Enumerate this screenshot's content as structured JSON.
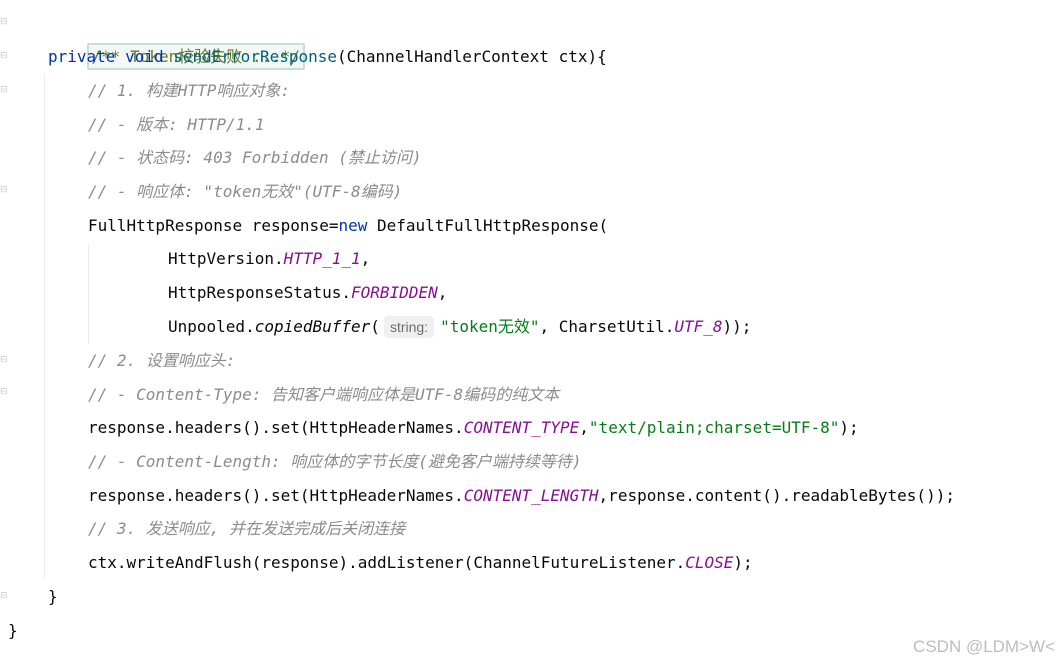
{
  "editor": {
    "doc_fold": "/** Token校验失败 ...*/",
    "method_sig": {
      "kw_private": "private",
      "kw_void": "void",
      "name": "sendErrorResponse",
      "params": "(ChannelHandlerContext ctx){"
    },
    "comments": {
      "c1": "// 1. 构建HTTP响应对象:",
      "c2": "// - 版本: HTTP/1.1",
      "c3": "// - 状态码: 403 Forbidden (禁止访问)",
      "c4": "// - 响应体: \"token无效\"(UTF-8编码)",
      "c5": "// 2. 设置响应头:",
      "c6": "// - Content-Type: 告知客户端响应体是UTF-8编码的纯文本",
      "c7": "// - Content-Length: 响应体的字节长度(避免客户端持续等待)",
      "c8": "// 3. 发送响应, 并在发送完成后关闭连接"
    },
    "line_resp": {
      "type": "FullHttpResponse response=",
      "kw_new": "new",
      "ctor": " DefaultFullHttpResponse("
    },
    "line_version": {
      "cls": "HttpVersion.",
      "field": "HTTP_1_1",
      "tail": ","
    },
    "line_status": {
      "cls": "HttpResponseStatus.",
      "field": "FORBIDDEN",
      "tail": ","
    },
    "line_buffer": {
      "cls": "Unpooled.",
      "method": "copiedBuffer",
      "open": "(",
      "hint": "string:",
      "str": "\"token无效\"",
      "mid": ", CharsetUtil.",
      "field": "UTF_8",
      "tail": "));"
    },
    "line_ct": {
      "pre": "response.headers().set(HttpHeaderNames.",
      "field": "CONTENT_TYPE",
      "comma": ",",
      "str": "\"text/plain;charset=UTF-8\"",
      "tail": ");"
    },
    "line_cl": {
      "pre": "response.headers().set(HttpHeaderNames.",
      "field": "CONTENT_LENGTH",
      "tail": ",response.content().readableBytes());"
    },
    "line_send": {
      "pre": "ctx.writeAndFlush(response).addListener(ChannelFutureListener.",
      "field": "CLOSE",
      "tail": ");"
    },
    "close_method": "}",
    "close_class": "}"
  },
  "watermark": "CSDN @LDM>W<"
}
